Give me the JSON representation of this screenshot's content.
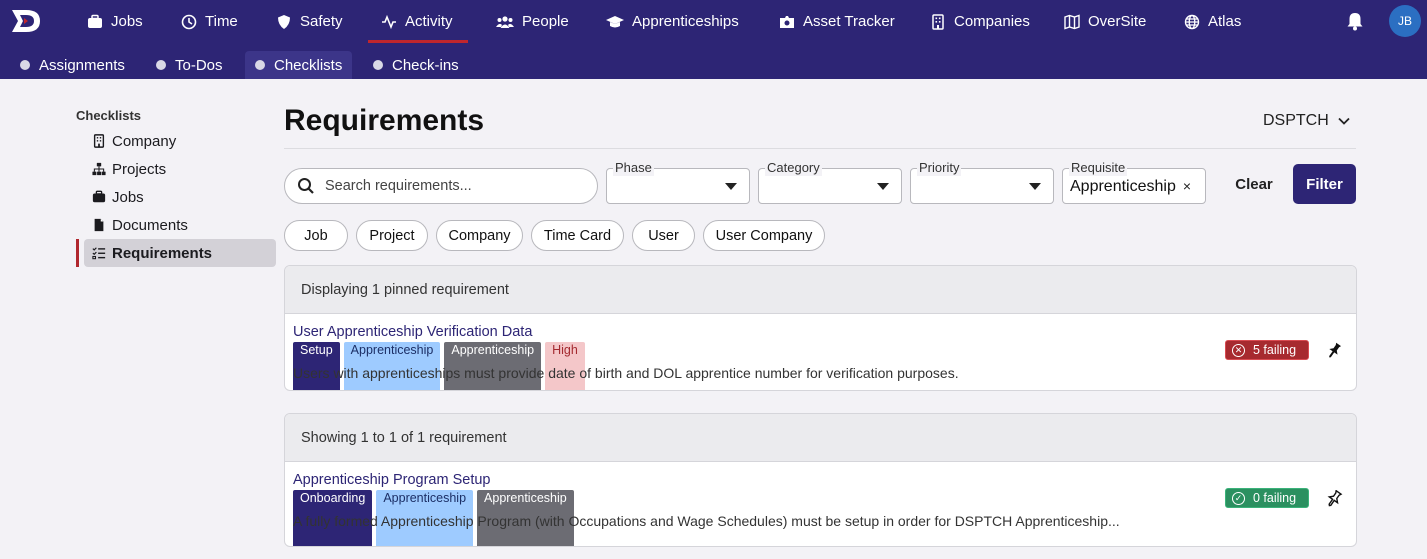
{
  "topnav": {
    "items": [
      {
        "label": "Jobs",
        "icon": "briefcase-icon"
      },
      {
        "label": "Time",
        "icon": "clock-icon"
      },
      {
        "label": "Safety",
        "icon": "shield-icon"
      },
      {
        "label": "Activity",
        "icon": "activity-icon"
      },
      {
        "label": "People",
        "icon": "people-icon"
      },
      {
        "label": "Apprenticeships",
        "icon": "graduation-cap-icon"
      },
      {
        "label": "Asset Tracker",
        "icon": "asset-icon"
      },
      {
        "label": "Companies",
        "icon": "building-icon"
      },
      {
        "label": "OverSite",
        "icon": "map-icon"
      },
      {
        "label": "Atlas",
        "icon": "globe-icon"
      }
    ],
    "active": "Activity",
    "avatar_initials": "JB"
  },
  "subnav": {
    "items": [
      {
        "label": "Assignments"
      },
      {
        "label": "To-Dos"
      },
      {
        "label": "Checklists"
      },
      {
        "label": "Check-ins"
      }
    ],
    "active": "Checklists"
  },
  "sidebar": {
    "title": "Checklists",
    "items": [
      {
        "label": "Company",
        "icon": "building-icon"
      },
      {
        "label": "Projects",
        "icon": "sitemap-icon"
      },
      {
        "label": "Jobs",
        "icon": "briefcase-icon"
      },
      {
        "label": "Documents",
        "icon": "document-icon"
      },
      {
        "label": "Requirements",
        "icon": "checklist-icon"
      }
    ],
    "active": "Requirements"
  },
  "main": {
    "title": "Requirements",
    "org": "DSPTCH",
    "search_placeholder": "Search requirements...",
    "filters": {
      "phase_label": "Phase",
      "category_label": "Category",
      "priority_label": "Priority",
      "requisite_label": "Requisite",
      "requisite_value": "Apprenticeship",
      "clear_x": "×"
    },
    "clear_label": "Clear",
    "filter_label": "Filter",
    "chips": [
      "Job",
      "Project",
      "Company",
      "Time Card",
      "User",
      "User Company"
    ]
  },
  "pinned": {
    "heading": "Displaying 1 pinned requirement",
    "item": {
      "title": "User Apprenticeship Verification Data",
      "tags": {
        "phase": "Setup",
        "category": "Apprenticeship",
        "requisite": "Apprenticeship",
        "priority": "High"
      },
      "description": "Users with apprenticeships must provide date of birth and DOL apprentice number for verification purposes.",
      "status": "5 failing",
      "status_color": "#a72a2f"
    }
  },
  "results": {
    "heading": "Showing 1 to 1 of 1 requirement",
    "item": {
      "title": "Apprenticeship Program Setup",
      "tags": {
        "phase": "Onboarding",
        "category": "Apprenticeship",
        "requisite": "Apprenticeship"
      },
      "description": "A fully formed Apprenticeship Program (with Occupations and Wage Schedules) must be setup in order for DSPTCH Apprenticeship...",
      "status": "0 failing",
      "status_color": "#2b9060"
    }
  },
  "colors": {
    "brand": "#2d2575",
    "accent": "#c0262d"
  }
}
